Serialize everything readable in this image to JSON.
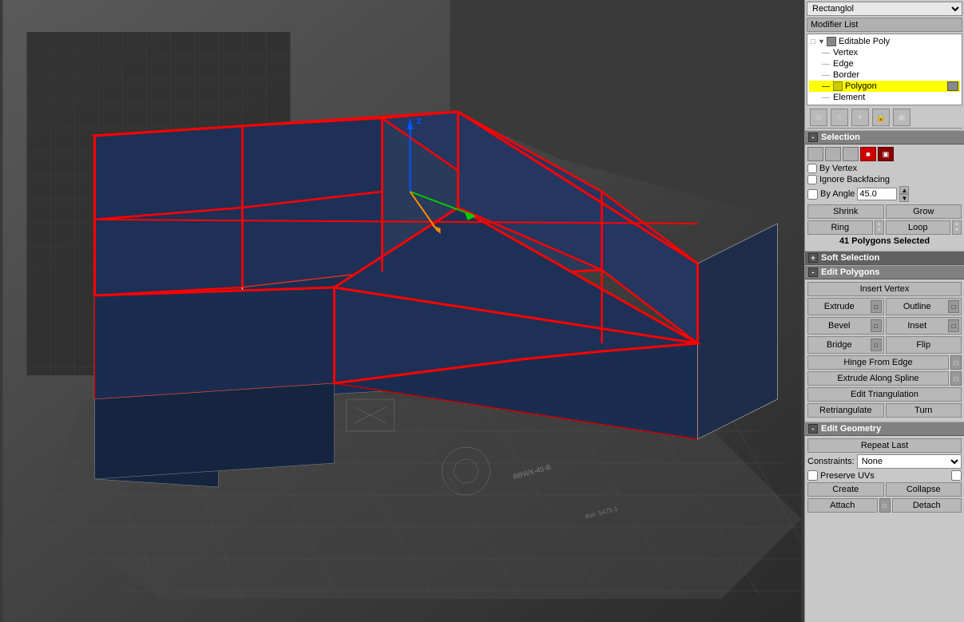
{
  "modifier": {
    "dropdown_value": "Rectanglol",
    "list_label": "Modifier List",
    "tree": {
      "items": [
        {
          "label": "Editable Poly",
          "level": 0,
          "icon": "gray",
          "selected": false
        },
        {
          "label": "Vertex",
          "level": 1,
          "icon": null,
          "selected": false
        },
        {
          "label": "Edge",
          "level": 1,
          "icon": null,
          "selected": false
        },
        {
          "label": "Border",
          "level": 1,
          "icon": null,
          "selected": false
        },
        {
          "label": "Polygon",
          "level": 1,
          "icon": "yellow",
          "selected": true
        },
        {
          "label": "Element",
          "level": 1,
          "icon": null,
          "selected": false
        }
      ]
    }
  },
  "selection": {
    "header": "Selection",
    "by_vertex": "By Vertex",
    "ignore_backfacing": "Ignore Backfacing",
    "by_angle": "By Angle",
    "angle_value": "45.0",
    "shrink_label": "Shrink",
    "grow_label": "Grow",
    "ring_label": "Ring",
    "loop_label": "Loop",
    "status": "41 Polygons Selected"
  },
  "soft_selection": {
    "header": "Soft Selection",
    "collapsed": true
  },
  "edit_polygons": {
    "header": "Edit Polygons",
    "insert_vertex": "Insert Vertex",
    "extrude": "Extrude",
    "outline": "Outline",
    "bevel": "Bevel",
    "inset": "Inset",
    "bridge": "Bridge",
    "flip": "Flip",
    "hinge_from_edge": "Hinge From Edge",
    "extrude_along_spline": "Extrude Along Spline",
    "edit_triangulation": "Edit Triangulation",
    "retriangulate": "Retriangulate",
    "turn": "Turn"
  },
  "edit_geometry": {
    "header": "Edit Geometry",
    "repeat_last": "Repeat Last",
    "constraints_label": "Constraints:",
    "constraints_value": "None",
    "preserve_uvs": "Preserve UVs",
    "create": "Create",
    "collapse": "Collapse",
    "attach": "Attach",
    "detach": "Detach"
  },
  "toolbar_icons": [
    "⊞",
    "≡",
    "✦",
    "🔒",
    "▣"
  ]
}
